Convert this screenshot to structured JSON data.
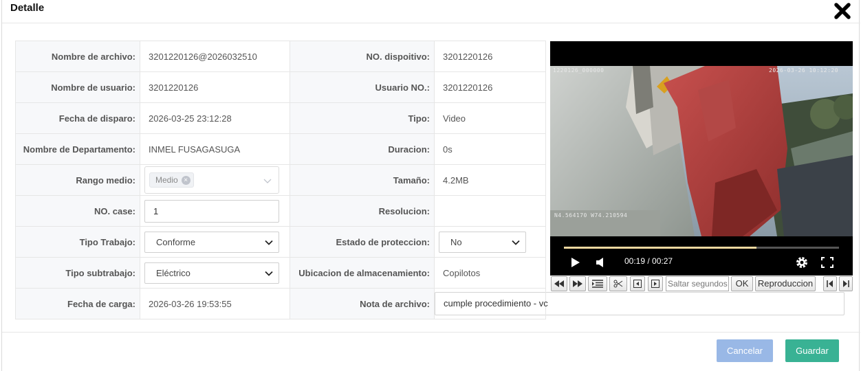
{
  "modal": {
    "title": "Detalle"
  },
  "fields": {
    "nombre_archivo": {
      "label": "Nombre de archivo:",
      "value": "3201220126@2026032510"
    },
    "no_dispositivo": {
      "label": "NO. dispoitivo:",
      "value": "3201220126"
    },
    "nombre_usuario": {
      "label": "Nombre de usuario:",
      "value": "3201220126"
    },
    "usuario_no": {
      "label": "Usuario NO.:",
      "value": "3201220126"
    },
    "fecha_disparo": {
      "label": "Fecha de disparo:",
      "value": "2026-03-25 23:12:28"
    },
    "tipo": {
      "label": "Tipo:",
      "value": "Video"
    },
    "departamento": {
      "label": "Nombre de Departamento:",
      "value": "INMEL FUSAGASUGA"
    },
    "duracion": {
      "label": "Duracion:",
      "value": "0s"
    },
    "rango_medio": {
      "label": "Rango medio:",
      "tag": "Medio"
    },
    "tamano": {
      "label": "Tamaño:",
      "value": "4.2MB"
    },
    "no_case": {
      "label": "NO. case:",
      "value": "1"
    },
    "resolucion": {
      "label": "Resolucion:",
      "value": ""
    },
    "tipo_trabajo": {
      "label": "Tipo Trabajo:",
      "value": "Conforme"
    },
    "estado_proteccion": {
      "label": "Estado de proteccion:",
      "value": "No"
    },
    "tipo_subtrabajo": {
      "label": "Tipo subtrabajo:",
      "value": "Eléctrico"
    },
    "ubicacion": {
      "label": "Ubicacion de almacenamiento:",
      "value": "Copilotos"
    },
    "fecha_carga": {
      "label": "Fecha de carga:",
      "value": "2026-03-26 19:53:55"
    },
    "nota_archivo": {
      "label": "Nota de archivo:",
      "value": "cumple procedimiento - vc"
    }
  },
  "video": {
    "osd_top_left": "1220126_000000",
    "osd_top_right": "2026-03-26 10:12:20",
    "osd_gps": "N4.564170  W74.210594",
    "time_display": "00:19 / 00:27",
    "progress": 0.7
  },
  "toolbar": {
    "jump_placeholder": "Saltar segundos",
    "ok_label": "OK",
    "playback_label": "Reproduccion"
  },
  "actions": {
    "cancel_label": "Cancelar",
    "save_label": "Guardar"
  },
  "colors": {
    "cancel_bg": "#99b8e6",
    "save_bg": "#39b294",
    "progress_fill": "#f0d8a0"
  }
}
